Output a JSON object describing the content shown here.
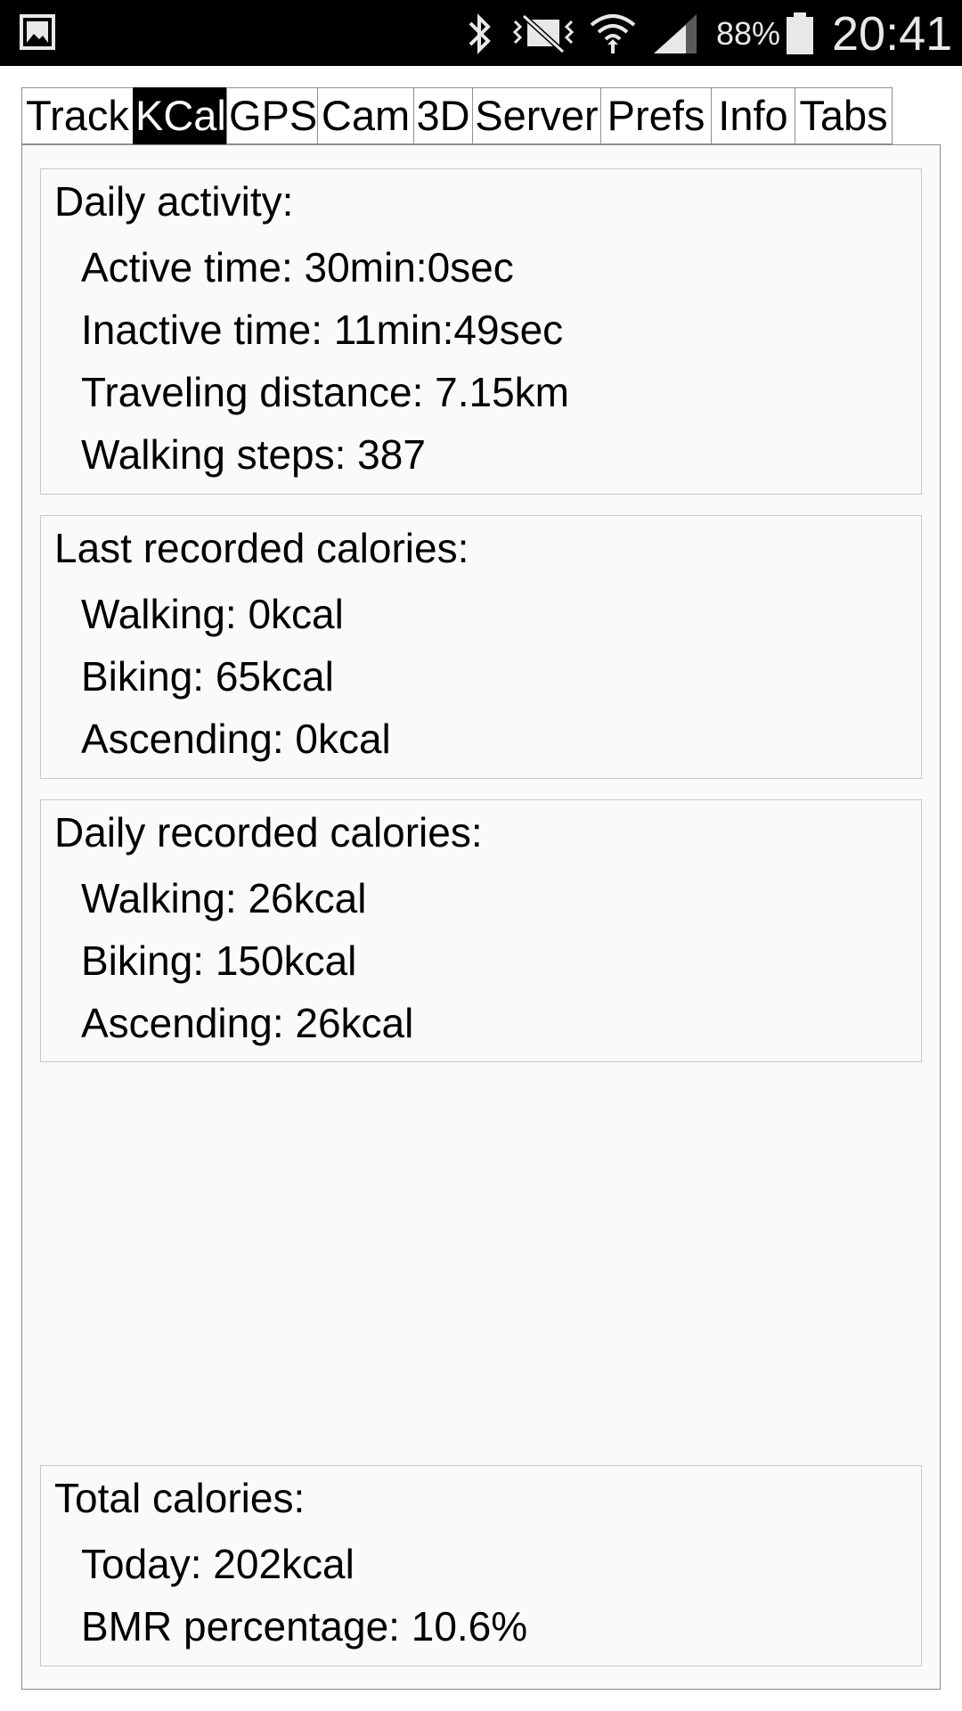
{
  "status_bar": {
    "left_icon": "gallery-icon",
    "icons": [
      "bluetooth-icon",
      "vibrate-mute-icon",
      "wifi-icon",
      "signal-icon"
    ],
    "battery_percent": "88%",
    "battery_icon": "battery-icon",
    "time": "20:41"
  },
  "tabs": [
    {
      "label": "Track",
      "active": false
    },
    {
      "label": "KCal",
      "active": true
    },
    {
      "label": "GPS",
      "active": false
    },
    {
      "label": "Cam",
      "active": false
    },
    {
      "label": "3D",
      "active": false
    },
    {
      "label": "Server",
      "active": false
    },
    {
      "label": "Prefs",
      "active": false
    },
    {
      "label": "Info",
      "active": false
    },
    {
      "label": "Tabs",
      "active": false
    }
  ],
  "daily_activity": {
    "title": "Daily activity:",
    "active_time": "Active time: 30min:0sec",
    "inactive_time": "Inactive time: 11min:49sec",
    "traveling_distance": "Traveling distance: 7.15km",
    "walking_steps": "Walking steps: 387"
  },
  "last_recorded": {
    "title": "Last recorded calories:",
    "walking": "Walking: 0kcal",
    "biking": "Biking: 65kcal",
    "ascending": "Ascending: 0kcal"
  },
  "daily_recorded": {
    "title": "Daily recorded calories:",
    "walking": "Walking: 26kcal",
    "biking": "Biking: 150kcal",
    "ascending": "Ascending: 26kcal"
  },
  "total_calories": {
    "title": "Total calories:",
    "today": "Today: 202kcal",
    "bmr_percentage": "BMR percentage: 10.6%"
  },
  "colors": {
    "status_bar_bg": "#000000",
    "active_tab_bg": "#000000",
    "active_tab_text": "#ffffff",
    "panel_bg": "#fafafa",
    "border": "#8e8e8e"
  }
}
